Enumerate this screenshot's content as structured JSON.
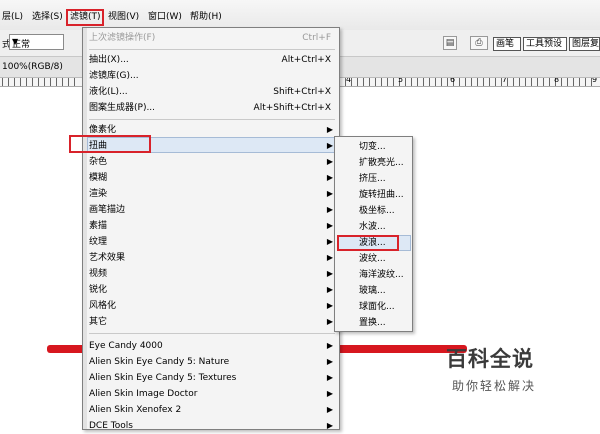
{
  "menubar": {
    "items": [
      "层(L)",
      "选择(S)",
      "滤镜(T)",
      "视图(V)",
      "窗口(W)",
      "帮助(H)"
    ]
  },
  "options": {
    "mode_label": "式:",
    "mode_value": "正常"
  },
  "tabs": [
    "画笔",
    "工具预设",
    "图层复"
  ],
  "document": {
    "zoom_title": "100%(RGB/8)"
  },
  "ruler": {
    "labels": [
      "4",
      "5",
      "6",
      "7",
      "8",
      "9"
    ]
  },
  "filter_menu": {
    "last_filter": "上次滤镜操作(F)",
    "last_filter_shortcut": "Ctrl+F",
    "group1": [
      {
        "label": "抽出(X)...",
        "shortcut": "Alt+Ctrl+X"
      },
      {
        "label": "滤镜库(G)...",
        "shortcut": ""
      },
      {
        "label": "液化(L)...",
        "shortcut": "Shift+Ctrl+X"
      },
      {
        "label": "图案生成器(P)...",
        "shortcut": "Alt+Shift+Ctrl+X"
      }
    ],
    "group2": [
      "像素化",
      "扭曲",
      "杂色",
      "模糊",
      "渲染",
      "画笔描边",
      "素描",
      "纹理",
      "艺术效果",
      "视频",
      "锐化",
      "风格化",
      "其它"
    ],
    "group3": [
      "Eye Candy 4000",
      "Alien Skin Eye Candy 5: Nature",
      "Alien Skin Eye Candy 5: Textures",
      "Alien Skin Image Doctor",
      "Alien Skin Xenofex 2",
      "DCE Tools"
    ]
  },
  "distort_submenu": [
    "切变...",
    "扩散亮光...",
    "挤压...",
    "旋转扭曲...",
    "极坐标...",
    "水波...",
    "波浪...",
    "波纹...",
    "海洋波纹...",
    "玻璃...",
    "球面化...",
    "置换..."
  ],
  "watermark": {
    "title": "百科全说",
    "subtitle": "助你轻松解决"
  },
  "colors": {
    "highlight_red": "#d8222a",
    "menu_hover": "#dde8f5"
  }
}
